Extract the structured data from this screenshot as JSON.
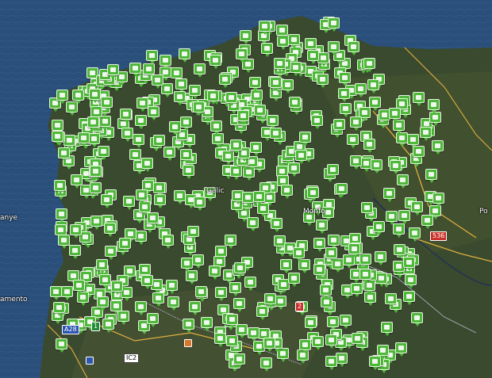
{
  "map": {
    "colors": {
      "ocean": "#2a4f7a",
      "land": "#3a4a2e",
      "marker": "#4fb83a",
      "road": "#e0b040",
      "border": "#b0b8c8"
    },
    "place_labels": [
      {
        "id": "galicia",
        "text": "Galic"
      },
      {
        "id": "monforte",
        "text": "Monfo"
      },
      {
        "id": "ponferrada",
        "text": "Po"
      },
      {
        "id": "left-edge-1",
        "text": "anye"
      },
      {
        "id": "left-edge-2",
        "text": "amento"
      }
    ],
    "road_shields": [
      {
        "id": "a28",
        "text": "A28",
        "style": "blue"
      },
      {
        "id": "e1",
        "text": "1",
        "style": "green"
      },
      {
        "id": "ic",
        "text": "IC2",
        "style": "white"
      },
      {
        "id": "n536",
        "text": "536",
        "style": "red"
      },
      {
        "id": "small-red",
        "text": "2",
        "style": "red"
      }
    ],
    "marker_icon": "landmark-pin-icon"
  }
}
